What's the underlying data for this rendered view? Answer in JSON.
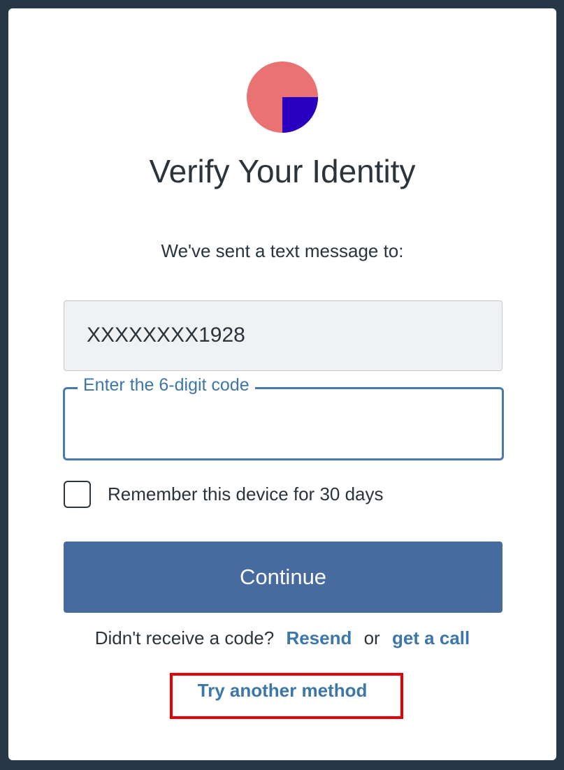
{
  "title": "Verify Your Identity",
  "subtitle": "We've sent a text message to:",
  "phone": {
    "value": "XXXXXXXX1928"
  },
  "code_field": {
    "label": "Enter the 6-digit code",
    "value": ""
  },
  "remember": {
    "label": "Remember this device for 30 days",
    "checked": false
  },
  "continue_label": "Continue",
  "resend": {
    "prompt": "Didn't receive a code?",
    "resend_label": "Resend",
    "or_text": "or",
    "call_label": "get a call"
  },
  "try_another_label": "Try another method",
  "colors": {
    "background": "#273746",
    "accent": "#476b9f",
    "link": "#3d76a8",
    "logo_primary": "#e97272",
    "logo_secondary": "#2a00c0",
    "highlight": "#e5000a"
  }
}
